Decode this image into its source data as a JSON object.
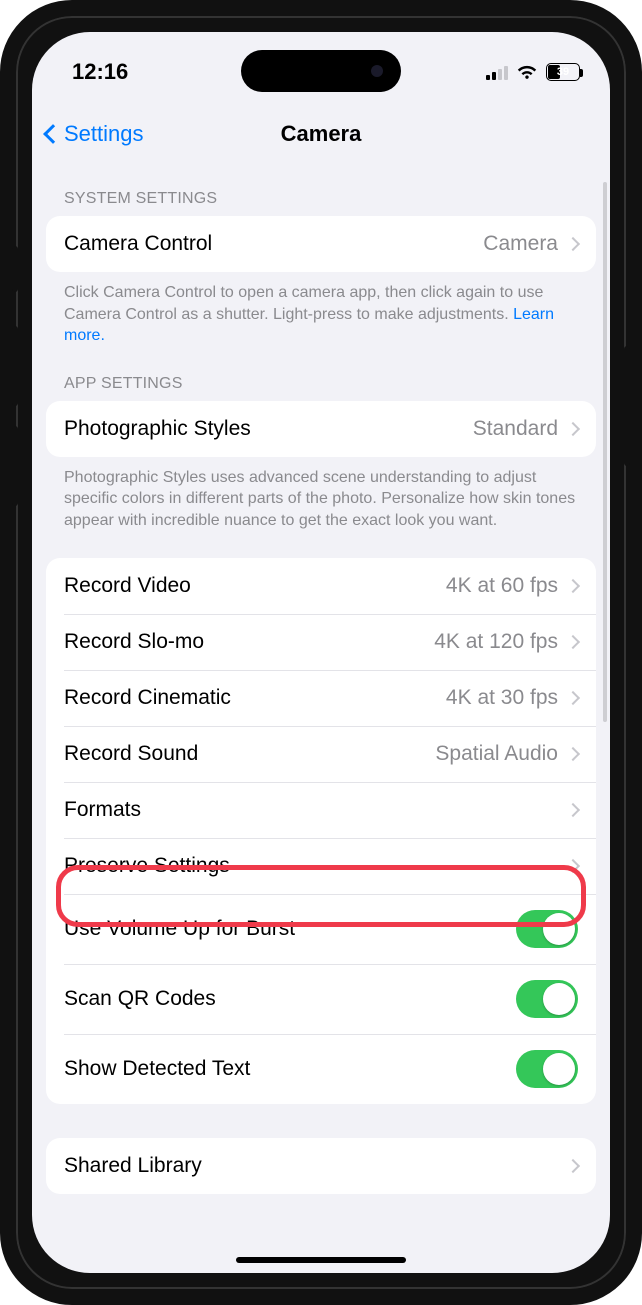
{
  "statusBar": {
    "time": "12:16",
    "batteryPercent": "39"
  },
  "nav": {
    "back": "Settings",
    "title": "Camera"
  },
  "sections": {
    "system": {
      "header": "SYSTEM SETTINGS",
      "cameraControl": {
        "label": "Camera Control",
        "value": "Camera"
      },
      "footer": "Click Camera Control to open a camera app, then click again to use Camera Control as a shutter. Light-press to make adjustments. ",
      "learnMore": "Learn more."
    },
    "app": {
      "header": "APP SETTINGS",
      "photoStyles": {
        "label": "Photographic Styles",
        "value": "Standard"
      },
      "footer": "Photographic Styles uses advanced scene understanding to adjust specific colors in different parts of the photo. Personalize how skin tones appear with incredible nuance to get the exact look you want."
    },
    "record": {
      "video": {
        "label": "Record Video",
        "value": "4K at 60 fps"
      },
      "slomo": {
        "label": "Record Slo-mo",
        "value": "4K at 120 fps"
      },
      "cinematic": {
        "label": "Record Cinematic",
        "value": "4K at 30 fps"
      },
      "sound": {
        "label": "Record Sound",
        "value": "Spatial Audio"
      },
      "formats": {
        "label": "Formats"
      },
      "preserve": {
        "label": "Preserve Settings"
      },
      "burst": {
        "label": "Use Volume Up for Burst"
      },
      "qr": {
        "label": "Scan QR Codes"
      },
      "text": {
        "label": "Show Detected Text"
      }
    },
    "shared": {
      "row": {
        "label": "Shared Library"
      }
    }
  }
}
